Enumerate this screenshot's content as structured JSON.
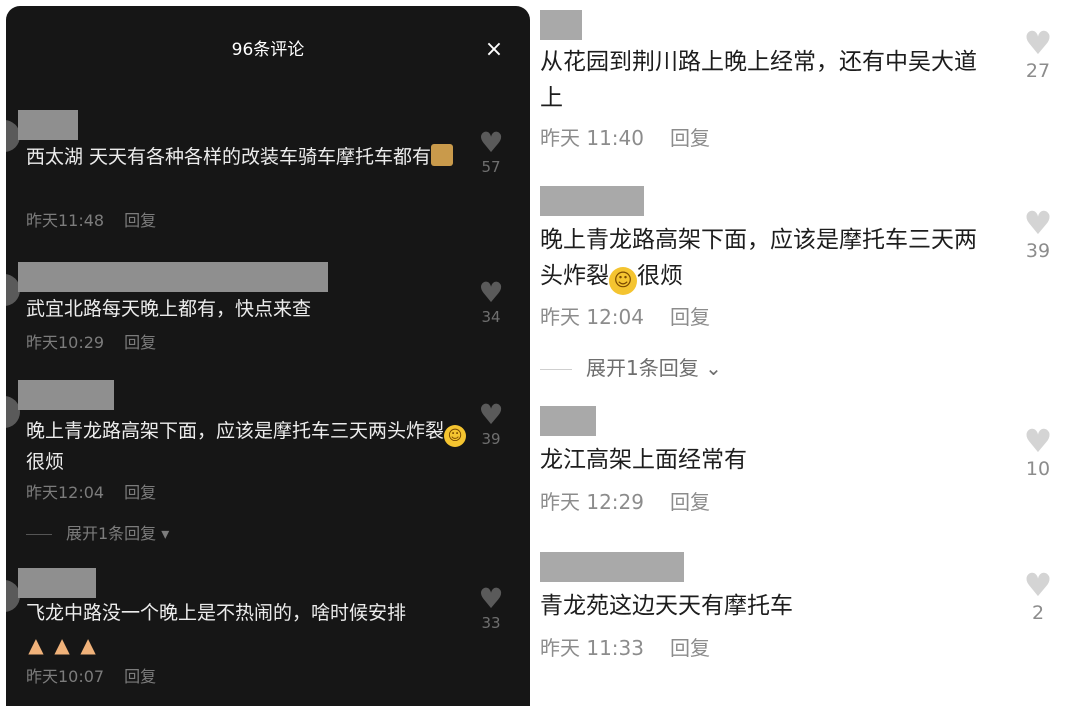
{
  "left": {
    "title": "96条评论",
    "close_icon": "×",
    "comments": [
      {
        "text": "西太湖 天天有各种各样的改装车骑车摩托车都有",
        "time": "昨天11:48",
        "reply": "回复",
        "likes": "57"
      },
      {
        "text": "武宜北路每天晚上都有，快点来查",
        "time": "昨天10:29",
        "reply": "回复",
        "likes": "34"
      },
      {
        "text": "晚上青龙路高架下面，应该是摩托车三天两头炸裂",
        "text_after": "很烦",
        "time": "昨天12:04",
        "reply": "回复",
        "likes": "39"
      },
      {
        "text": "飞龙中路没一个晚上是不热闹的，啥时候安排",
        "time": "昨天10:07",
        "reply": "回复",
        "likes": "33"
      }
    ],
    "expand_label": "展开1条回复"
  },
  "right": {
    "comments": [
      {
        "text": "从花园到荆川路上晚上经常，还有中吴大道上",
        "time": "昨天 11:40",
        "reply": "回复",
        "likes": "27"
      },
      {
        "text": "晚上青龙路高架下面，应该是摩托车三天两头炸裂",
        "text_after": "很烦",
        "time": "昨天 12:04",
        "reply": "回复",
        "likes": "39"
      },
      {
        "text": "龙江高架上面经常有",
        "time": "昨天 12:29",
        "reply": "回复",
        "likes": "10"
      },
      {
        "text": "青龙苑这边天天有摩托车",
        "time": "昨天 11:33",
        "reply": "回复",
        "likes": "2"
      }
    ],
    "expand_label": "展开1条回复"
  },
  "icons": {
    "heart": "heart-icon",
    "close": "close-icon",
    "chevron": "chevron-down-icon"
  }
}
